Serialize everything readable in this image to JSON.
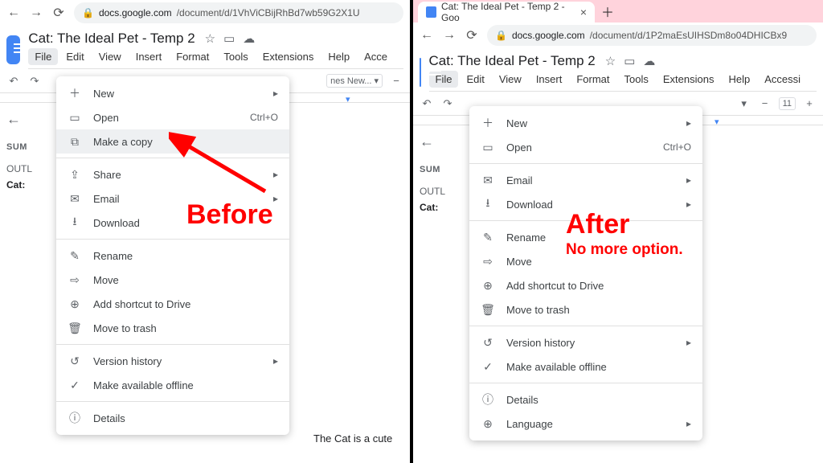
{
  "left": {
    "url_host": "docs.google.com",
    "url_path": "/document/d/1VhViCBijRhBd7wb59G2X1U",
    "doc_title": "Cat: The Ideal Pet - Temp 2",
    "menus": [
      "File",
      "Edit",
      "View",
      "Insert",
      "Format",
      "Tools",
      "Extensions",
      "Help",
      "Acce"
    ],
    "font_label": "nes New...",
    "outline": {
      "summary": "SUM",
      "outline_label": "OUTL",
      "item": "Cat:"
    },
    "dropdown": [
      {
        "icon": "＋",
        "label": "New",
        "meta": "▸"
      },
      {
        "icon": "▭",
        "label": "Open",
        "meta": "Ctrl+O"
      },
      {
        "icon": "⧉",
        "label": "Make a copy",
        "hl": true
      },
      {
        "sep": true
      },
      {
        "icon": "⇪",
        "label": "Share",
        "meta": "▸"
      },
      {
        "icon": "✉",
        "label": "Email",
        "meta": "▸"
      },
      {
        "icon": "⭳",
        "label": "Download"
      },
      {
        "sep": true
      },
      {
        "icon": "✎",
        "label": "Rename"
      },
      {
        "icon": "⇨",
        "label": "Move"
      },
      {
        "icon": "⊕",
        "label": "Add shortcut to Drive"
      },
      {
        "icon": "🗑",
        "label": "Move to trash"
      },
      {
        "sep": true
      },
      {
        "icon": "↺",
        "label": "Version history",
        "meta": "▸"
      },
      {
        "icon": "✓",
        "label": "Make available offline"
      },
      {
        "sep": true
      },
      {
        "icon": "ⓘ",
        "label": "Details"
      }
    ],
    "doc_body_text": "The Cat is a cute",
    "annotation": "Before"
  },
  "right": {
    "tab_title": "Cat: The Ideal Pet - Temp 2 - Goo",
    "url_host": "docs.google.com",
    "url_path": "/document/d/1P2maEsUIHSDm8o04DHICBx9",
    "doc_title": "Cat: The Ideal Pet - Temp 2",
    "menus": [
      "File",
      "Edit",
      "View",
      "Insert",
      "Format",
      "Tools",
      "Extensions",
      "Help",
      "Accessi"
    ],
    "font_size": "11",
    "outline": {
      "summary": "SUM",
      "outline_label": "OUTL",
      "item": "Cat:"
    },
    "dropdown": [
      {
        "icon": "＋",
        "label": "New",
        "meta": "▸"
      },
      {
        "icon": "▭",
        "label": "Open",
        "meta": "Ctrl+O"
      },
      {
        "sep": true
      },
      {
        "icon": "✉",
        "label": "Email",
        "meta": "▸"
      },
      {
        "icon": "⭳",
        "label": "Download",
        "meta": "▸"
      },
      {
        "sep": true
      },
      {
        "icon": "✎",
        "label": "Rename"
      },
      {
        "icon": "⇨",
        "label": "Move"
      },
      {
        "icon": "⊕",
        "label": "Add shortcut to Drive"
      },
      {
        "icon": "🗑",
        "label": "Move to trash"
      },
      {
        "sep": true
      },
      {
        "icon": "↺",
        "label": "Version history",
        "meta": "▸"
      },
      {
        "icon": "✓",
        "label": "Make available offline"
      },
      {
        "sep": true
      },
      {
        "icon": "ⓘ",
        "label": "Details"
      },
      {
        "icon": "⊕",
        "label": "Language",
        "meta": "▸"
      }
    ],
    "annotation_big": "After",
    "annotation_small": "No more option."
  }
}
